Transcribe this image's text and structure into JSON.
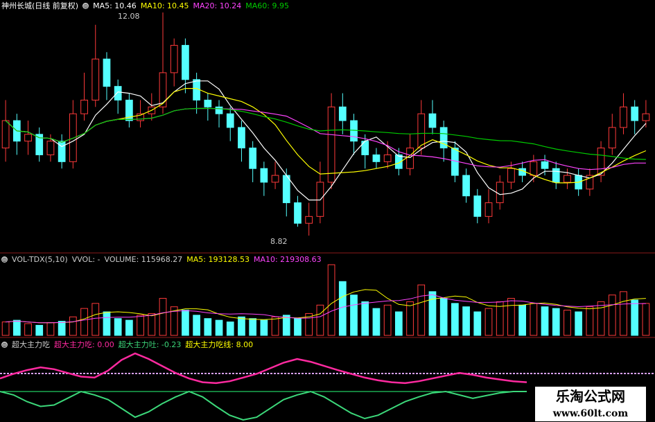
{
  "price_panel": {
    "title": "神州长城(日线 前复权)",
    "icon": "settings-circle-icon",
    "ma5": "MA5: 10.46",
    "ma10": "MA10: 10.45",
    "ma20": "MA20: 10.24",
    "ma60": "MA60: 9.95",
    "high_label": "12.08",
    "low_label": "8.82"
  },
  "volume_panel": {
    "title": "VOL-TDX(5,10)",
    "vvol": "VVOL: -",
    "volume": "VOLUME: 115968.27",
    "ma5": "MA5: 193128.53",
    "ma10": "MA10: 219308.63"
  },
  "indicator_panel": {
    "title": "超大主力吃",
    "eat": "超大主力吃: 0.00",
    "spit": "超大主力吐: -0.23",
    "line": "超大主力吃线: 8.00"
  },
  "watermark": {
    "line1": "乐淘公式网",
    "line2": "www.60lt.com"
  },
  "colors": {
    "up": "#ff3a3a",
    "down": "#54ffff",
    "ma5": "#ffffff",
    "ma10": "#ffff00",
    "ma20": "#ff44ff",
    "ma60": "#00cc00",
    "eat_line": "#ff2aa0",
    "spit_line": "#3cd87a"
  },
  "chart_data": {
    "type": "candlestick",
    "price_range": [
      8.82,
      12.08
    ],
    "candles": [
      [
        10.1,
        10.5,
        10.8,
        9.9
      ],
      [
        10.5,
        10.2,
        10.6,
        10.0
      ],
      [
        10.2,
        10.3,
        10.5,
        10.0
      ],
      [
        10.3,
        10.0,
        10.4,
        9.9
      ],
      [
        10.0,
        10.2,
        10.3,
        9.9
      ],
      [
        10.2,
        9.9,
        10.3,
        9.8
      ],
      [
        9.9,
        10.6,
        10.8,
        9.8
      ],
      [
        10.6,
        10.8,
        11.2,
        10.5
      ],
      [
        10.8,
        11.4,
        11.9,
        10.7
      ],
      [
        11.4,
        11.0,
        11.5,
        10.8
      ],
      [
        11.0,
        10.8,
        11.1,
        10.6
      ],
      [
        10.8,
        10.5,
        10.9,
        10.4
      ],
      [
        10.5,
        10.6,
        10.8,
        10.4
      ],
      [
        10.6,
        10.7,
        10.9,
        10.5
      ],
      [
        10.7,
        11.2,
        12.08,
        10.6
      ],
      [
        11.2,
        11.6,
        11.7,
        11.0
      ],
      [
        11.6,
        11.1,
        11.7,
        10.9
      ],
      [
        11.1,
        10.8,
        11.2,
        10.6
      ],
      [
        10.8,
        10.7,
        10.9,
        10.5
      ],
      [
        10.7,
        10.6,
        10.8,
        10.4
      ],
      [
        10.6,
        10.4,
        10.7,
        10.2
      ],
      [
        10.4,
        10.1,
        10.5,
        9.9
      ],
      [
        10.1,
        9.8,
        10.2,
        9.6
      ],
      [
        9.8,
        9.6,
        9.9,
        9.4
      ],
      [
        9.6,
        9.7,
        9.9,
        9.5
      ],
      [
        9.7,
        9.3,
        9.8,
        9.1
      ],
      [
        9.3,
        9.0,
        9.4,
        8.95
      ],
      [
        9.0,
        9.1,
        9.3,
        8.82
      ],
      [
        9.1,
        9.6,
        9.9,
        9.0
      ],
      [
        9.6,
        10.7,
        10.9,
        9.5
      ],
      [
        10.7,
        10.5,
        10.9,
        10.3
      ],
      [
        10.5,
        10.2,
        10.6,
        10.0
      ],
      [
        10.2,
        10.0,
        10.3,
        9.8
      ],
      [
        10.0,
        9.9,
        10.1,
        9.8
      ],
      [
        9.9,
        10.0,
        10.2,
        9.8
      ],
      [
        10.0,
        9.8,
        10.1,
        9.7
      ],
      [
        9.8,
        10.1,
        10.3,
        9.7
      ],
      [
        10.1,
        10.6,
        10.8,
        10.0
      ],
      [
        10.6,
        10.4,
        10.8,
        10.3
      ],
      [
        10.4,
        10.1,
        10.5,
        9.9
      ],
      [
        10.1,
        9.7,
        10.2,
        9.6
      ],
      [
        9.7,
        9.4,
        9.8,
        9.3
      ],
      [
        9.4,
        9.1,
        9.5,
        9.0
      ],
      [
        9.1,
        9.3,
        9.5,
        9.0
      ],
      [
        9.3,
        9.6,
        9.7,
        9.2
      ],
      [
        9.6,
        9.8,
        9.9,
        9.5
      ],
      [
        9.8,
        9.7,
        9.9,
        9.6
      ],
      [
        9.7,
        9.9,
        10.0,
        9.6
      ],
      [
        9.9,
        9.8,
        10.0,
        9.7
      ],
      [
        9.8,
        9.6,
        9.9,
        9.5
      ],
      [
        9.6,
        9.7,
        9.8,
        9.5
      ],
      [
        9.7,
        9.5,
        9.8,
        9.4
      ],
      [
        9.5,
        9.7,
        9.8,
        9.4
      ],
      [
        9.7,
        10.1,
        10.2,
        9.6
      ],
      [
        10.1,
        10.4,
        10.6,
        10.0
      ],
      [
        10.4,
        10.7,
        10.9,
        10.3
      ],
      [
        10.7,
        10.5,
        10.8,
        10.3
      ],
      [
        10.5,
        10.6,
        10.8,
        10.4
      ]
    ],
    "volumes": [
      40,
      45,
      35,
      30,
      38,
      42,
      55,
      80,
      95,
      70,
      50,
      45,
      60,
      65,
      110,
      85,
      75,
      60,
      50,
      45,
      40,
      55,
      50,
      45,
      55,
      60,
      50,
      65,
      90,
      210,
      160,
      120,
      100,
      80,
      90,
      70,
      100,
      150,
      130,
      110,
      95,
      85,
      70,
      80,
      100,
      110,
      90,
      95,
      85,
      80,
      75,
      70,
      85,
      100,
      120,
      130,
      105,
      95
    ],
    "eat_line_values": [
      28,
      38,
      46,
      52,
      48,
      40,
      32,
      30,
      45,
      68,
      82,
      70,
      55,
      40,
      28,
      20,
      18,
      22,
      30,
      38,
      50,
      62,
      70,
      64,
      55,
      46,
      38,
      30,
      24,
      20,
      18,
      22,
      28,
      34,
      40,
      36,
      30,
      26,
      22,
      20
    ],
    "spit_line_values": [
      0,
      -5,
      -15,
      -22,
      -20,
      -10,
      0,
      -5,
      -12,
      -25,
      -38,
      -30,
      -18,
      -8,
      0,
      -8,
      -22,
      -35,
      -42,
      -38,
      -25,
      -12,
      -5,
      0,
      -8,
      -20,
      -32,
      -40,
      -35,
      -25,
      -15,
      -8,
      -2,
      0,
      -5,
      -10,
      -6,
      -2,
      0,
      0
    ],
    "eat_threshold": 8.0
  }
}
